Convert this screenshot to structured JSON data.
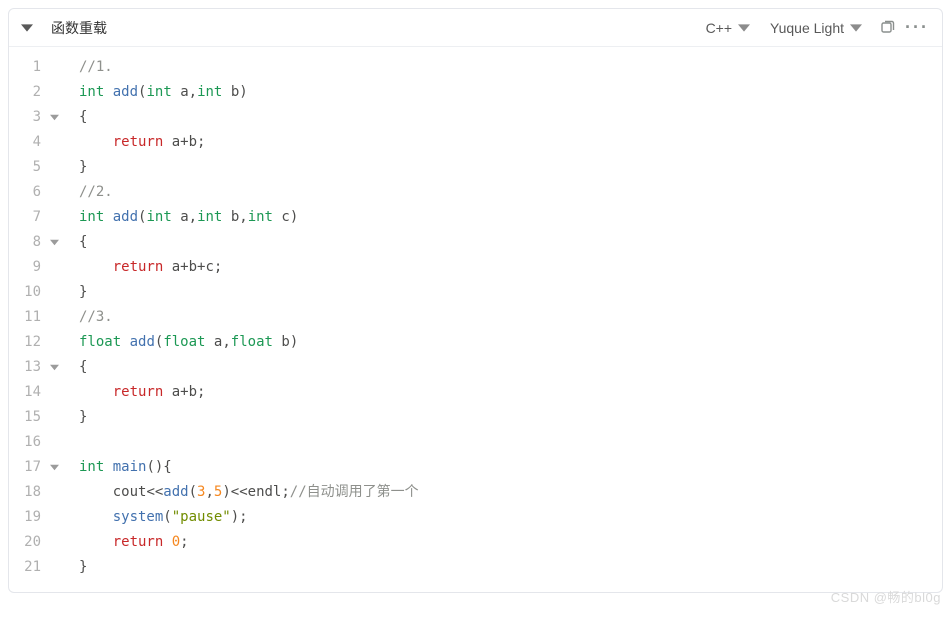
{
  "header": {
    "title": "函数重载",
    "language": "C++",
    "theme": "Yuque Light"
  },
  "code": {
    "lines": [
      {
        "n": 1,
        "fold": "",
        "tokens": [
          [
            "comment",
            "//1."
          ]
        ]
      },
      {
        "n": 2,
        "fold": "",
        "tokens": [
          [
            "type",
            "int"
          ],
          [
            "punct",
            " "
          ],
          [
            "func",
            "add"
          ],
          [
            "punct",
            "("
          ],
          [
            "type",
            "int"
          ],
          [
            "punct",
            " "
          ],
          [
            "ident",
            "a"
          ],
          [
            "punct",
            ","
          ],
          [
            "type",
            "int"
          ],
          [
            "punct",
            " "
          ],
          [
            "ident",
            "b"
          ],
          [
            "punct",
            ")"
          ]
        ]
      },
      {
        "n": 3,
        "fold": "down",
        "tokens": [
          [
            "punct",
            "{"
          ]
        ]
      },
      {
        "n": 4,
        "fold": "",
        "tokens": [
          [
            "punct",
            "    "
          ],
          [
            "keyword",
            "return"
          ],
          [
            "punct",
            " "
          ],
          [
            "ident",
            "a"
          ],
          [
            "punct",
            "+"
          ],
          [
            "ident",
            "b"
          ],
          [
            "punct",
            ";"
          ]
        ]
      },
      {
        "n": 5,
        "fold": "",
        "tokens": [
          [
            "punct",
            "}"
          ]
        ]
      },
      {
        "n": 6,
        "fold": "",
        "tokens": [
          [
            "comment",
            "//2."
          ]
        ]
      },
      {
        "n": 7,
        "fold": "",
        "tokens": [
          [
            "type",
            "int"
          ],
          [
            "punct",
            " "
          ],
          [
            "func",
            "add"
          ],
          [
            "punct",
            "("
          ],
          [
            "type",
            "int"
          ],
          [
            "punct",
            " "
          ],
          [
            "ident",
            "a"
          ],
          [
            "punct",
            ","
          ],
          [
            "type",
            "int"
          ],
          [
            "punct",
            " "
          ],
          [
            "ident",
            "b"
          ],
          [
            "punct",
            ","
          ],
          [
            "type",
            "int"
          ],
          [
            "punct",
            " "
          ],
          [
            "ident",
            "c"
          ],
          [
            "punct",
            ")"
          ]
        ]
      },
      {
        "n": 8,
        "fold": "down",
        "tokens": [
          [
            "punct",
            "{"
          ]
        ]
      },
      {
        "n": 9,
        "fold": "",
        "tokens": [
          [
            "punct",
            "    "
          ],
          [
            "keyword",
            "return"
          ],
          [
            "punct",
            " "
          ],
          [
            "ident",
            "a"
          ],
          [
            "punct",
            "+"
          ],
          [
            "ident",
            "b"
          ],
          [
            "punct",
            "+"
          ],
          [
            "ident",
            "c"
          ],
          [
            "punct",
            ";"
          ]
        ]
      },
      {
        "n": 10,
        "fold": "",
        "tokens": [
          [
            "punct",
            "}"
          ]
        ]
      },
      {
        "n": 11,
        "fold": "",
        "tokens": [
          [
            "comment",
            "//3."
          ]
        ]
      },
      {
        "n": 12,
        "fold": "",
        "tokens": [
          [
            "type",
            "float"
          ],
          [
            "punct",
            " "
          ],
          [
            "func",
            "add"
          ],
          [
            "punct",
            "("
          ],
          [
            "type",
            "float"
          ],
          [
            "punct",
            " "
          ],
          [
            "ident",
            "a"
          ],
          [
            "punct",
            ","
          ],
          [
            "type",
            "float"
          ],
          [
            "punct",
            " "
          ],
          [
            "ident",
            "b"
          ],
          [
            "punct",
            ")"
          ]
        ]
      },
      {
        "n": 13,
        "fold": "down",
        "tokens": [
          [
            "punct",
            "{"
          ]
        ]
      },
      {
        "n": 14,
        "fold": "",
        "tokens": [
          [
            "punct",
            "    "
          ],
          [
            "keyword",
            "return"
          ],
          [
            "punct",
            " "
          ],
          [
            "ident",
            "a"
          ],
          [
            "punct",
            "+"
          ],
          [
            "ident",
            "b"
          ],
          [
            "punct",
            ";"
          ]
        ]
      },
      {
        "n": 15,
        "fold": "",
        "tokens": [
          [
            "punct",
            "}"
          ]
        ]
      },
      {
        "n": 16,
        "fold": "",
        "tokens": []
      },
      {
        "n": 17,
        "fold": "down",
        "tokens": [
          [
            "type",
            "int"
          ],
          [
            "punct",
            " "
          ],
          [
            "func",
            "main"
          ],
          [
            "punct",
            "(){"
          ]
        ]
      },
      {
        "n": 18,
        "fold": "",
        "tokens": [
          [
            "punct",
            "    "
          ],
          [
            "ident",
            "cout"
          ],
          [
            "punct",
            "<<"
          ],
          [
            "func",
            "add"
          ],
          [
            "punct",
            "("
          ],
          [
            "num",
            "3"
          ],
          [
            "punct",
            ","
          ],
          [
            "num",
            "5"
          ],
          [
            "punct",
            ")<<"
          ],
          [
            "ident",
            "endl"
          ],
          [
            "punct",
            ";"
          ],
          [
            "comment",
            "//自动调用了第一个"
          ]
        ]
      },
      {
        "n": 19,
        "fold": "",
        "tokens": [
          [
            "punct",
            "    "
          ],
          [
            "func",
            "system"
          ],
          [
            "punct",
            "("
          ],
          [
            "str",
            "\"pause\""
          ],
          [
            "punct",
            ");"
          ]
        ]
      },
      {
        "n": 20,
        "fold": "",
        "tokens": [
          [
            "punct",
            "    "
          ],
          [
            "keyword",
            "return"
          ],
          [
            "punct",
            " "
          ],
          [
            "num",
            "0"
          ],
          [
            "punct",
            ";"
          ]
        ]
      },
      {
        "n": 21,
        "fold": "",
        "tokens": [
          [
            "punct",
            "}"
          ]
        ]
      }
    ]
  },
  "watermark": "CSDN @畅的bl0g"
}
